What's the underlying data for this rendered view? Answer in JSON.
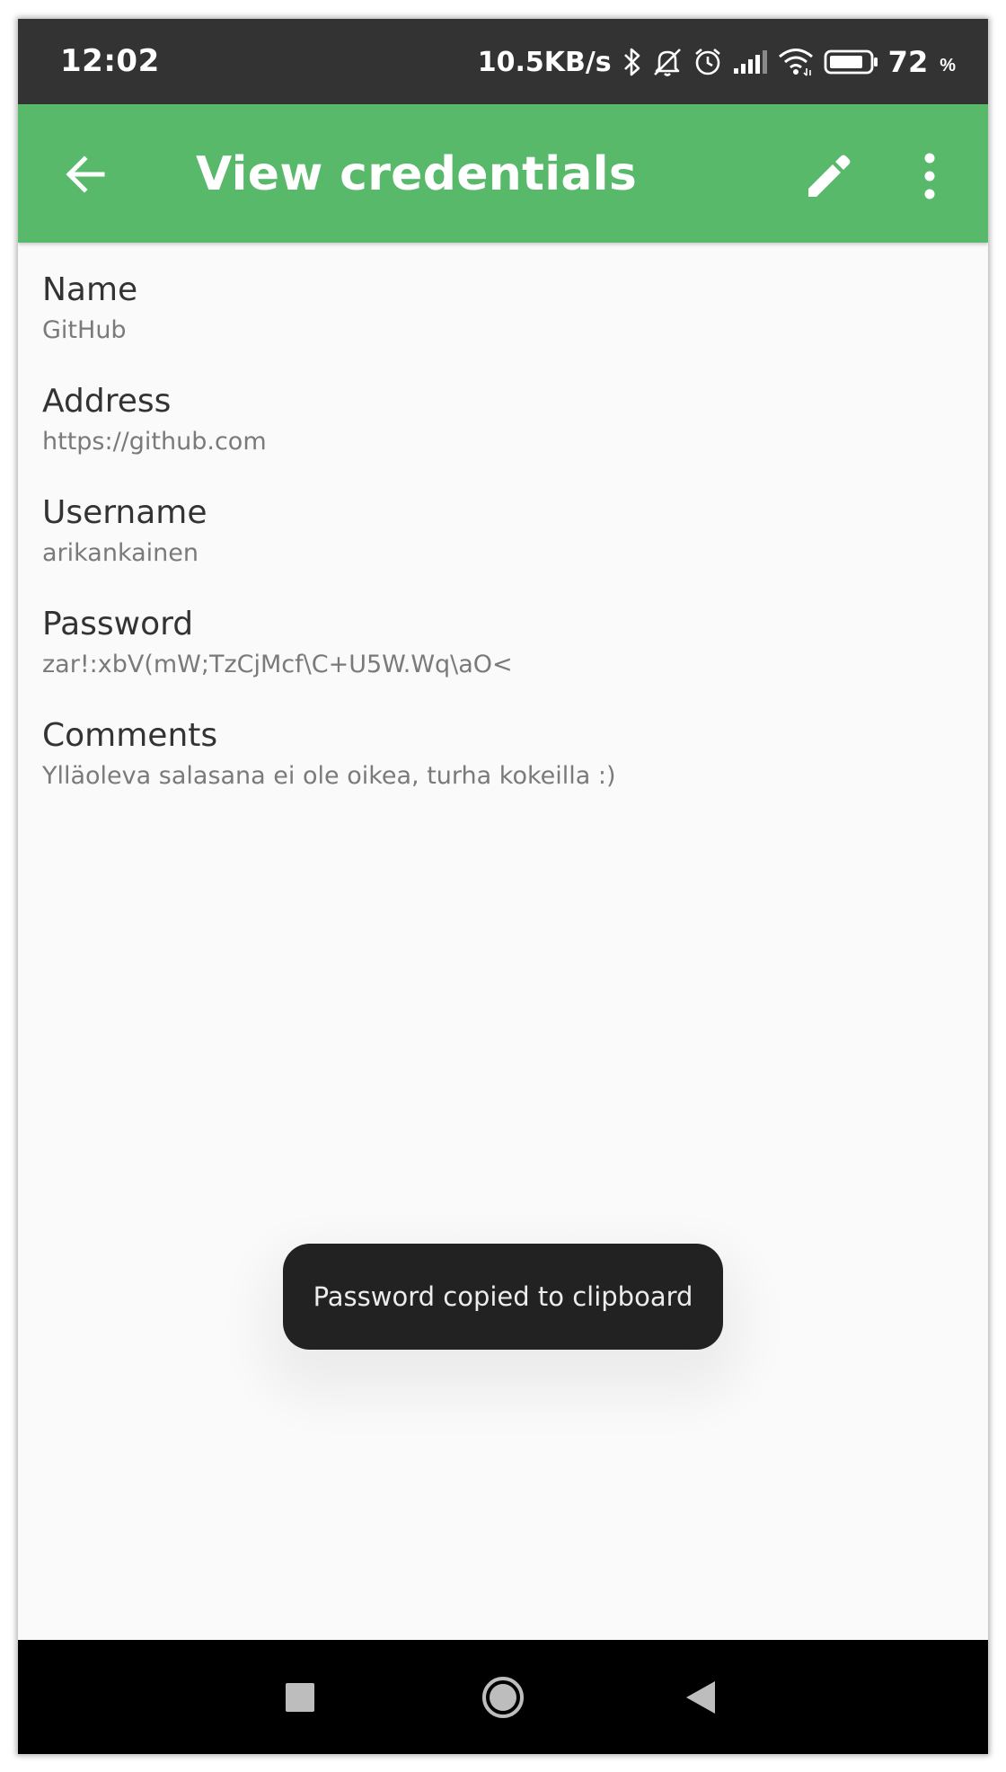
{
  "status_bar": {
    "time": "12:02",
    "network_speed": "10.5KB/s",
    "battery_level": "72",
    "battery_unit": "%",
    "icons": [
      "bluetooth-icon",
      "mute-icon",
      "alarm-icon",
      "signal-icon",
      "wifi-icon",
      "battery-icon"
    ]
  },
  "app_bar": {
    "title": "View credentials",
    "color": "#58b96a",
    "icons": [
      "back-arrow-icon",
      "edit-pencil-icon",
      "more-vert-icon"
    ]
  },
  "fields": [
    {
      "label": "Name",
      "value": "GitHub"
    },
    {
      "label": "Address",
      "value": "https://github.com"
    },
    {
      "label": "Username",
      "value": "arikankainen"
    },
    {
      "label": "Password",
      "value": "zar!:xbV(mW;TzCjMcf\\C+U5W.Wq\\aO<"
    },
    {
      "label": "Comments",
      "value": "Ylläoleva salasana ei ole oikea, turha kokeilla :)"
    }
  ],
  "toast": {
    "message": "Password copied to clipboard"
  },
  "nav_bar": {
    "icons": [
      "recents-square-icon",
      "home-circle-icon",
      "back-triangle-icon"
    ]
  }
}
